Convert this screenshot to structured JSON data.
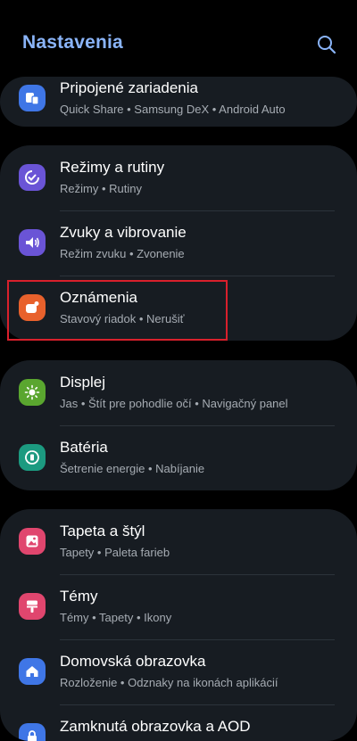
{
  "header": {
    "title": "Nastavenia",
    "search_icon": "search-icon"
  },
  "colors": {
    "accent": "#8ab4f8",
    "card_bg": "#171c22",
    "highlight": "#d9202c"
  },
  "groups": [
    {
      "items": [
        {
          "id": "pripojene",
          "label": "Pripojené zariadenia",
          "sub": "Quick Share  •  Samsung DeX  •  Android Auto",
          "icon": "connected-devices-icon",
          "color": "#3f76e6"
        }
      ]
    },
    {
      "items": [
        {
          "id": "rezimy",
          "label": "Režimy a rutiny",
          "sub": "Režimy  •  Rutiny",
          "icon": "modes-routines-icon",
          "color": "#6a54d6"
        },
        {
          "id": "zvuky",
          "label": "Zvuky a vibrovanie",
          "sub": "Režim zvuku  •  Zvonenie",
          "icon": "sound-icon",
          "color": "#6a54d6"
        },
        {
          "id": "oznamenia",
          "label": "Oznámenia",
          "sub": "Stavový riadok  •  Nerušiť",
          "icon": "notifications-icon",
          "color": "#e8612c"
        }
      ]
    },
    {
      "items": [
        {
          "id": "displej",
          "label": "Displej",
          "sub": "Jas  •  Štít pre pohodlie očí  •  Navigačný panel",
          "icon": "display-icon",
          "color": "#5aa62f"
        },
        {
          "id": "bateria",
          "label": "Batéria",
          "sub": "Šetrenie energie  •  Nabíjanie",
          "icon": "battery-icon",
          "color": "#1c9a80"
        }
      ]
    },
    {
      "items": [
        {
          "id": "tapeta",
          "label": "Tapeta a štýl",
          "sub": "Tapety  •  Paleta farieb",
          "icon": "wallpaper-icon",
          "color": "#e0466e"
        },
        {
          "id": "temy",
          "label": "Témy",
          "sub": "Témy  •  Tapety  •  Ikony",
          "icon": "themes-icon",
          "color": "#e0466e"
        },
        {
          "id": "domovska",
          "label": "Domovská obrazovka",
          "sub": "Rozloženie  •  Odznaky na ikonách aplikácií",
          "icon": "home-icon",
          "color": "#3f76e6"
        },
        {
          "id": "zamknuta",
          "label": "Zamknutá obrazovka a AOD",
          "sub": "",
          "icon": "lock-screen-icon",
          "color": "#3f76e6"
        }
      ]
    }
  ]
}
